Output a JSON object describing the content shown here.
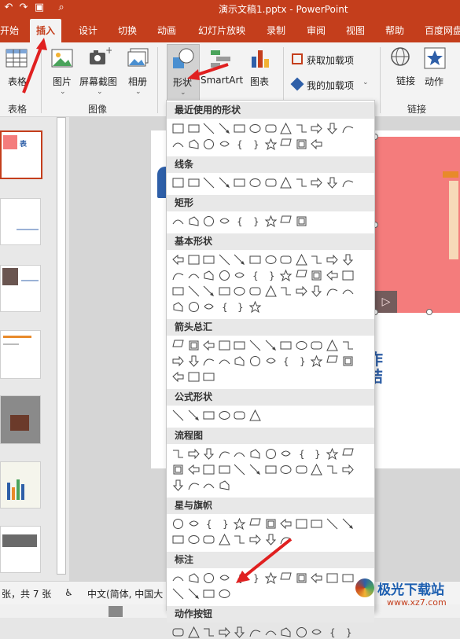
{
  "window": {
    "title": "演示文稿1.pptx  -  PowerPoint"
  },
  "quick_access": {
    "icons": [
      "undo-icon",
      "redo-icon",
      "present-icon",
      "preview-icon"
    ]
  },
  "tabs": [
    "开始",
    "插入",
    "设计",
    "切换",
    "动画",
    "幻灯片放映",
    "录制",
    "审阅",
    "视图",
    "帮助",
    "百度网盘"
  ],
  "active_tab": "插入",
  "ribbon": {
    "table": "表格",
    "picture": "图片",
    "screenshot": "屏幕截图",
    "album": "相册",
    "shapes": "形状",
    "smartart": "SmartArt",
    "chart": "图表",
    "get_addins": "获取加载项",
    "my_addins": "我的加载项",
    "link": "链接",
    "action": "动作",
    "groups": {
      "table": "表格",
      "images": "图像",
      "links": "链接"
    }
  },
  "dropdown": {
    "sections": [
      {
        "title": "最近使用的形状",
        "count": 22
      },
      {
        "title": "线条",
        "count": 12
      },
      {
        "title": "矩形",
        "count": 9
      },
      {
        "title": "基本形状",
        "count": 42
      },
      {
        "title": "箭头总汇",
        "count": 27
      },
      {
        "title": "公式形状",
        "count": 6
      },
      {
        "title": "流程图",
        "count": 28
      },
      {
        "title": "星与旗帜",
        "count": 20
      },
      {
        "title": "标注",
        "count": 16
      },
      {
        "title": "动作按钮",
        "count": 12
      }
    ]
  },
  "slide_panel": {
    "thumb_text": "表"
  },
  "slide": {
    "text": "作结"
  },
  "statusbar": {
    "slide_count": "张，共 7 张",
    "language": "中文(简体, 中国大"
  },
  "watermark": {
    "name": "极光下载站",
    "url": "www.xz7.com"
  },
  "colors": {
    "accent": "#c43e1c",
    "slide_image": "#f47c7c",
    "text_blue": "#2e5fa8"
  }
}
